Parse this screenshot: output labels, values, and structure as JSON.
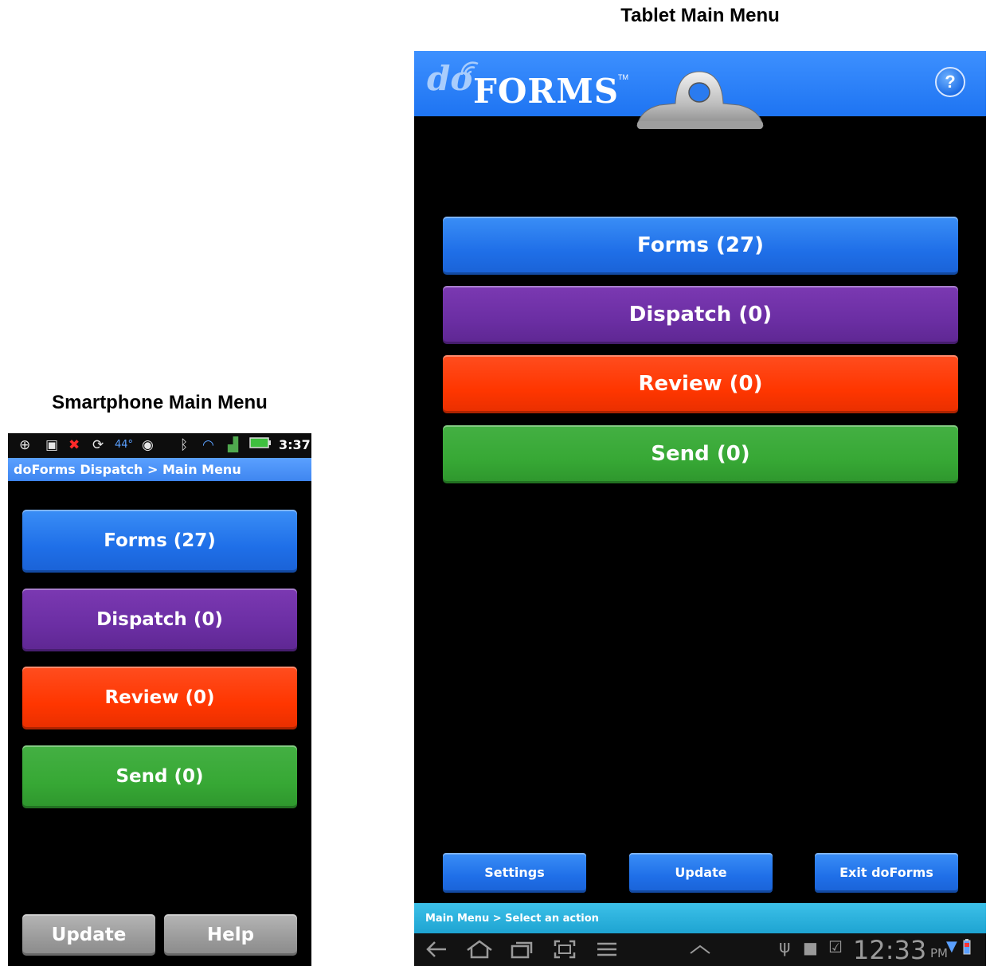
{
  "tablet": {
    "caption": "Tablet Main Menu",
    "brand_do": "do",
    "brand_forms": "FORMS",
    "brand_tm": "TM",
    "help_label": "?",
    "buttons": [
      {
        "label": "Forms (27)",
        "color": "#1f6fe8"
      },
      {
        "label": "Dispatch (0)",
        "color": "#6b2ea3"
      },
      {
        "label": "Review (0)",
        "color": "#ff3600"
      },
      {
        "label": "Send (0)",
        "color": "#37a835"
      }
    ],
    "bottom_buttons": {
      "settings": "Settings",
      "update": "Update",
      "exit": "Exit doForms"
    },
    "breadcrumb": "Main Menu > Select an action",
    "clock": "12:33",
    "ampm": "PM"
  },
  "phone": {
    "caption": "Smartphone Main Menu",
    "status": {
      "temp": "44°",
      "time": "3:37"
    },
    "title": "doForms Dispatch > Main Menu",
    "buttons": [
      {
        "label": "Forms (27)",
        "color": "#1f6fe8"
      },
      {
        "label": "Dispatch (0)",
        "color": "#6b2ea3"
      },
      {
        "label": "Review (0)",
        "color": "#ff3600"
      },
      {
        "label": "Send (0)",
        "color": "#37a835"
      }
    ],
    "bottom_buttons": {
      "update": "Update",
      "help": "Help"
    }
  }
}
